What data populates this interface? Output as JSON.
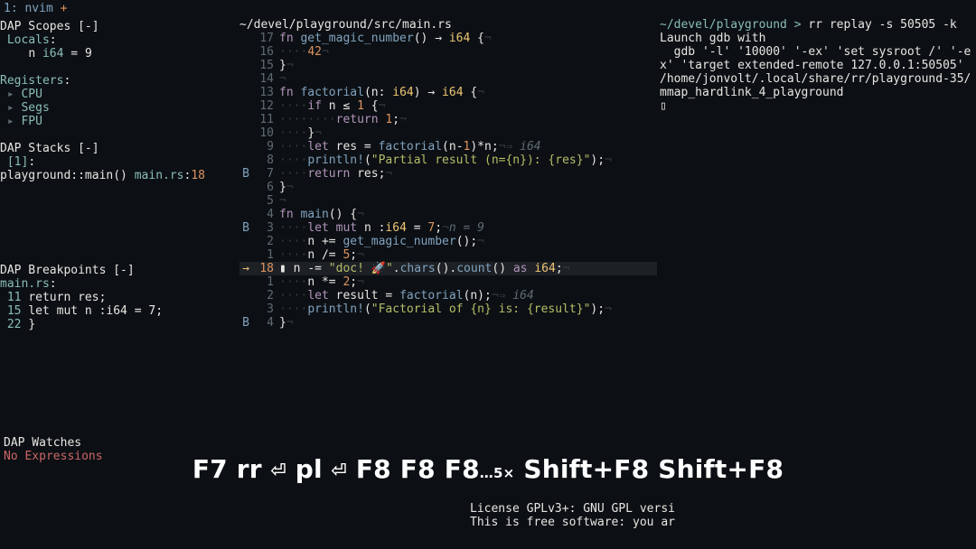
{
  "tab": {
    "index": "1:",
    "name": "nvim",
    "plus": "+"
  },
  "sidebar": {
    "scopes_header": "DAP Scopes [-]",
    "locals_label": "Locals",
    "locals_var": "n",
    "locals_type": "i64",
    "locals_eq": "=",
    "locals_val": "9",
    "registers_label": "Registers",
    "reg_items": [
      "CPU",
      "Segs",
      "FPU"
    ],
    "stacks_header": "DAP Stacks [-]",
    "stack_idx": "[1]",
    "stack_frame_ns": "playground::main()",
    "stack_file": "main.rs",
    "stack_line": "18",
    "bps_header": "DAP Breakpoints [-]",
    "bps_file": "main.rs",
    "bps": [
      {
        "ln": "11",
        "txt": "return res;"
      },
      {
        "ln": "15",
        "txt": "let mut n :i64 = 7;"
      },
      {
        "ln": "22",
        "txt": "}"
      }
    ],
    "watches_header": "DAP Watches",
    "no_expr": "No Expressions"
  },
  "editor": {
    "path": "~/devel/playground/src/main.rs",
    "lines": [
      {
        "g": "",
        "rl": "17",
        "seg": [
          [
            "purple-kw",
            "fn "
          ],
          [
            "fn-name",
            "get_magic_number"
          ],
          [
            "white",
            "() "
          ],
          [
            "white",
            "→ "
          ],
          [
            "type",
            "i64"
          ],
          [
            "white",
            " {"
          ],
          [
            "whitespace",
            "¬"
          ]
        ]
      },
      {
        "g": "",
        "rl": "16",
        "seg": [
          [
            "whitespace",
            "····"
          ],
          [
            "num",
            "42"
          ],
          [
            "whitespace",
            "¬"
          ]
        ]
      },
      {
        "g": "",
        "rl": "15",
        "seg": [
          [
            "white",
            "}"
          ],
          [
            "whitespace",
            "¬"
          ]
        ]
      },
      {
        "g": "",
        "rl": "14",
        "seg": [
          [
            "whitespace",
            "¬"
          ]
        ]
      },
      {
        "g": "",
        "rl": "13",
        "seg": [
          [
            "purple-kw",
            "fn "
          ],
          [
            "fn-name",
            "factorial"
          ],
          [
            "white",
            "(n: "
          ],
          [
            "type",
            "i64"
          ],
          [
            "white",
            ") "
          ],
          [
            "white",
            "→ "
          ],
          [
            "type",
            "i64"
          ],
          [
            "white",
            " {"
          ],
          [
            "whitespace",
            "¬"
          ]
        ]
      },
      {
        "g": "",
        "rl": "12",
        "seg": [
          [
            "whitespace",
            "····"
          ],
          [
            "purple-kw",
            "if "
          ],
          [
            "var",
            "n ≤ "
          ],
          [
            "num",
            "1"
          ],
          [
            "white",
            " {"
          ],
          [
            "whitespace",
            "¬"
          ]
        ]
      },
      {
        "g": "",
        "rl": "11",
        "seg": [
          [
            "whitespace",
            "····"
          ],
          [
            "whitespace",
            "····"
          ],
          [
            "purple-kw",
            "return "
          ],
          [
            "num",
            "1"
          ],
          [
            "white",
            ";"
          ],
          [
            "whitespace",
            "¬"
          ]
        ]
      },
      {
        "g": "",
        "rl": "10",
        "seg": [
          [
            "whitespace",
            "····"
          ],
          [
            "white",
            "}"
          ],
          [
            "whitespace",
            "¬"
          ]
        ]
      },
      {
        "g": "",
        "rl": "9",
        "seg": [
          [
            "whitespace",
            "····"
          ],
          [
            "purple-kw",
            "let "
          ],
          [
            "var",
            "res"
          ],
          [
            "white",
            " = "
          ],
          [
            "fn-name",
            "factorial"
          ],
          [
            "white",
            "(n-"
          ],
          [
            "num",
            "1"
          ],
          [
            "white",
            ")*n;"
          ],
          [
            "whitespace",
            "¬⇒ "
          ],
          [
            "comment",
            "i64"
          ]
        ]
      },
      {
        "g": "",
        "rl": "8",
        "seg": [
          [
            "whitespace",
            "····"
          ],
          [
            "fn-name",
            "println!"
          ],
          [
            "white",
            "("
          ],
          [
            "string",
            "\"Partial result (n={n}): {res}\""
          ],
          [
            "white",
            ");"
          ],
          [
            "whitespace",
            "¬"
          ]
        ]
      },
      {
        "g": "B",
        "rl": "7",
        "seg": [
          [
            "whitespace",
            "····"
          ],
          [
            "purple-kw",
            "return "
          ],
          [
            "var",
            "res"
          ],
          [
            "white",
            ";"
          ],
          [
            "whitespace",
            "¬"
          ]
        ]
      },
      {
        "g": "",
        "rl": "6",
        "seg": [
          [
            "white",
            "}"
          ],
          [
            "whitespace",
            "¬"
          ]
        ]
      },
      {
        "g": "",
        "rl": "5",
        "seg": [
          [
            "whitespace",
            "¬"
          ]
        ]
      },
      {
        "g": "",
        "rl": "4",
        "seg": [
          [
            "purple-kw",
            "fn "
          ],
          [
            "fn-name",
            "main"
          ],
          [
            "white",
            "() {"
          ],
          [
            "whitespace",
            "¬"
          ]
        ]
      },
      {
        "g": "B",
        "rl": "3",
        "seg": [
          [
            "whitespace",
            "····"
          ],
          [
            "purple-kw",
            "let mut "
          ],
          [
            "var",
            "n "
          ],
          [
            "white",
            ":"
          ],
          [
            "type",
            "i64"
          ],
          [
            "white",
            " = "
          ],
          [
            "num",
            "7"
          ],
          [
            "white",
            ";"
          ],
          [
            "whitespace",
            "¬"
          ],
          [
            "comment",
            "n = 9"
          ]
        ]
      },
      {
        "g": "",
        "rl": "2",
        "seg": [
          [
            "whitespace",
            "····"
          ],
          [
            "var",
            "n "
          ],
          [
            "white",
            "+= "
          ],
          [
            "fn-name",
            "get_magic_number"
          ],
          [
            "white",
            "();"
          ],
          [
            "whitespace",
            "¬"
          ]
        ]
      },
      {
        "g": "",
        "rl": "1",
        "seg": [
          [
            "whitespace",
            "····"
          ],
          [
            "var",
            "n "
          ],
          [
            "white",
            "∕= "
          ],
          [
            "num",
            "5"
          ],
          [
            "white",
            ";"
          ],
          [
            "whitespace",
            "¬"
          ]
        ]
      },
      {
        "g": "→",
        "rl": "18",
        "cur": true,
        "seg": [
          [
            "pill",
            "▮ "
          ],
          [
            "var",
            "n "
          ],
          [
            "white",
            "-= "
          ],
          [
            "string",
            "\"doc! 🚀\""
          ],
          [
            "white",
            "."
          ],
          [
            "fn-name",
            "chars"
          ],
          [
            "white",
            "()."
          ],
          [
            "fn-name",
            "count"
          ],
          [
            "white",
            "() "
          ],
          [
            "purple-kw",
            "as "
          ],
          [
            "type",
            "i64"
          ],
          [
            "white",
            ";"
          ],
          [
            "whitespace",
            "¬"
          ]
        ]
      },
      {
        "g": "",
        "rl": "1",
        "seg": [
          [
            "whitespace",
            "····"
          ],
          [
            "var",
            "n "
          ],
          [
            "white",
            "*= "
          ],
          [
            "num",
            "2"
          ],
          [
            "white",
            ";"
          ],
          [
            "whitespace",
            "¬"
          ]
        ]
      },
      {
        "g": "",
        "rl": "2",
        "seg": [
          [
            "whitespace",
            "····"
          ],
          [
            "purple-kw",
            "let "
          ],
          [
            "var",
            "result"
          ],
          [
            "white",
            " = "
          ],
          [
            "fn-name",
            "factorial"
          ],
          [
            "white",
            "(n);"
          ],
          [
            "whitespace",
            "¬⇒ "
          ],
          [
            "comment",
            "i64"
          ]
        ]
      },
      {
        "g": "",
        "rl": "3",
        "seg": [
          [
            "whitespace",
            "····"
          ],
          [
            "fn-name",
            "println!"
          ],
          [
            "white",
            "("
          ],
          [
            "string",
            "\"Factorial of {n} is: {result}\""
          ],
          [
            "white",
            ");"
          ],
          [
            "whitespace",
            "¬"
          ]
        ]
      },
      {
        "g": "B",
        "rl": "4",
        "seg": [
          [
            "white",
            "}"
          ],
          [
            "whitespace",
            "¬"
          ]
        ]
      }
    ]
  },
  "term": {
    "prompt_path": "~/devel/playground",
    "gt": ">",
    "cmd": "rr replay -s 50505 -k",
    "out1": "Launch gdb with",
    "out2": "  gdb '-l' '10000' '-ex' 'set sysroot /' '-ex' 'target extended-remote 127.0.0.1:50505' /home/jonvolt/.local/share/rr/playground-35/mmap_hardlink_4_playground",
    "cursor": "▯"
  },
  "legal": {
    "l1": "License GPLv3+: GNU GPL versi",
    "l2": "This is free software: you ar"
  },
  "keyseq": {
    "f7": "F7",
    "rr": "rr",
    "ret": "⏎",
    "pl": "pl",
    "f8": "F8",
    "more": "…5×",
    "sh": "Shift+F8"
  }
}
